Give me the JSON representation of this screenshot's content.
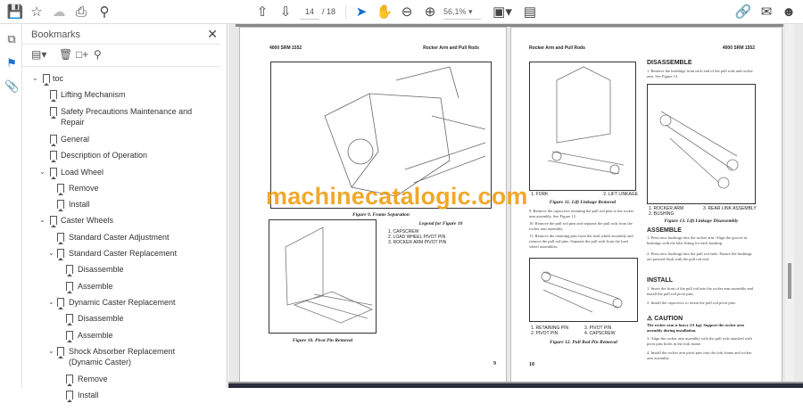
{
  "toolbar": {
    "page_current": "14",
    "page_total": "/ 18",
    "zoom": "56,1%"
  },
  "icons": {
    "save": "save-icon",
    "bookmark": "star-icon",
    "upload": "cloud-upload-icon",
    "print": "print-icon",
    "search": "search-icon",
    "prev": "arrow-up-circle-icon",
    "next": "arrow-down-circle-icon",
    "select": "cursor-icon",
    "hand": "hand-icon",
    "zoom_out": "zoom-out-icon",
    "zoom_in": "zoom-in-icon",
    "fit": "fit-page-icon",
    "scroll": "scroll-mode-icon",
    "share": "share-link-icon",
    "mail": "mail-icon",
    "account": "account-icon"
  },
  "bookmarks": {
    "title": "Bookmarks",
    "items": [
      {
        "label": "toc",
        "level": 0,
        "chev": "v"
      },
      {
        "label": "Lifting Mechanism",
        "level": 1
      },
      {
        "label": "Safety Precautions Maintenance and Repair",
        "level": 1
      },
      {
        "label": "General",
        "level": 1
      },
      {
        "label": "Description of Operation",
        "level": 1
      },
      {
        "label": "Load Wheel",
        "level": 1,
        "chev": "v"
      },
      {
        "label": "Remove",
        "level": 2
      },
      {
        "label": "Install",
        "level": 2
      },
      {
        "label": "Caster Wheels",
        "level": 1,
        "chev": "v"
      },
      {
        "label": "Standard Caster Adjustment",
        "level": 2
      },
      {
        "label": "Standard Caster Replacement",
        "level": 2,
        "chev": "v"
      },
      {
        "label": "Disassemble",
        "level": 3
      },
      {
        "label": "Assemble",
        "level": 3
      },
      {
        "label": "Dynamic Caster Replacement",
        "level": 2,
        "chev": "v"
      },
      {
        "label": "Disassemble",
        "level": 3
      },
      {
        "label": "Assemble",
        "level": 3
      },
      {
        "label": "Shock Absorber Replacement (Dynamic Caster)",
        "level": 2,
        "chev": "v"
      },
      {
        "label": "Remove",
        "level": 3
      },
      {
        "label": "Install",
        "level": 3
      }
    ]
  },
  "left_page": {
    "header_left": "4000 SRM 1552",
    "header_right": "Rocker Arm and Pull Rods",
    "fig9_caption": "Figure 9. Frame Separation",
    "legend_title": "Legend for Figure 10",
    "legend": [
      "1.   CAPSCREW",
      "2.   LOAD WHEEL PIVOT PIN",
      "3.   ROCKER ARM PIVOT PIN"
    ],
    "fig10_caption": "Figure 10. Pivot Pin Removal",
    "page_number": "9"
  },
  "right_page": {
    "header_left": "Rocker Arm and Pull Rods",
    "header_right": "4000 SRM 1552",
    "fig11_legend": [
      "1.   FORK",
      "2.   LIFT LINKAGE"
    ],
    "fig11_caption": "Figure 11. Lift Linkage Removal",
    "steps_left": [
      "9.  Remove the capscrews retaining the pull rod pins to the rocker arm assembly. See Figure 12.",
      "10. Remove the pull rod pins and separate the pull rods from the rocker arm assembly.",
      "11. Remove the retaining pins from the load wheel assembly and remove the pull rod pins. Separate the pull rods from the load wheel assemblies."
    ],
    "fig12_legend": [
      "1.  RETAINING PIN",
      "2.  PIVOT PIN",
      "3.  PIVOT PIN",
      "4.  CAPSCREW"
    ],
    "fig12_caption": "Figure 12. Pull Rod Pin Removal",
    "disassemble": "DISASSEMBLE",
    "dis_step": "1. Remove the bushings from each end of the pull rods and rocker arm. See Figure 13.",
    "fig13_legend": [
      "1.  ROCKER ARM",
      "2.  BUSHING",
      "3.  REAR LINK ASSEMBLY"
    ],
    "fig13_caption": "Figure 13. Lift Linkage Disassembly",
    "assemble": "ASSEMBLE",
    "asm_steps": [
      "1. Press new bushings into the rocker arm. Align the groove in bushings with the lube fitting for each bushing.",
      "2. Press new bushings into the pull rod ends. Ensure the bushings are pressed flush with the pull rod end."
    ],
    "install": "INSTALL",
    "inst_steps": [
      "1. Insert the front of the pull rod into the rocker arm assembly and install the pull rod pivot pins.",
      "2. Install the capscrews to retain the pull rod pivot pins."
    ],
    "caution": "CAUTION",
    "caution_text": "The rocker arm is heavy (11 kg). Support the rocker arm assembly during installation.",
    "inst_steps2": [
      "3. Align the rocker arm assembly with the pull rods attached with pivot pins holes in the fork frame.",
      "4. Install the rocker arm pivot pins into the fork frame and rocker arm assembly."
    ],
    "page_number": "10"
  },
  "watermark": "machinecatalogic.com"
}
